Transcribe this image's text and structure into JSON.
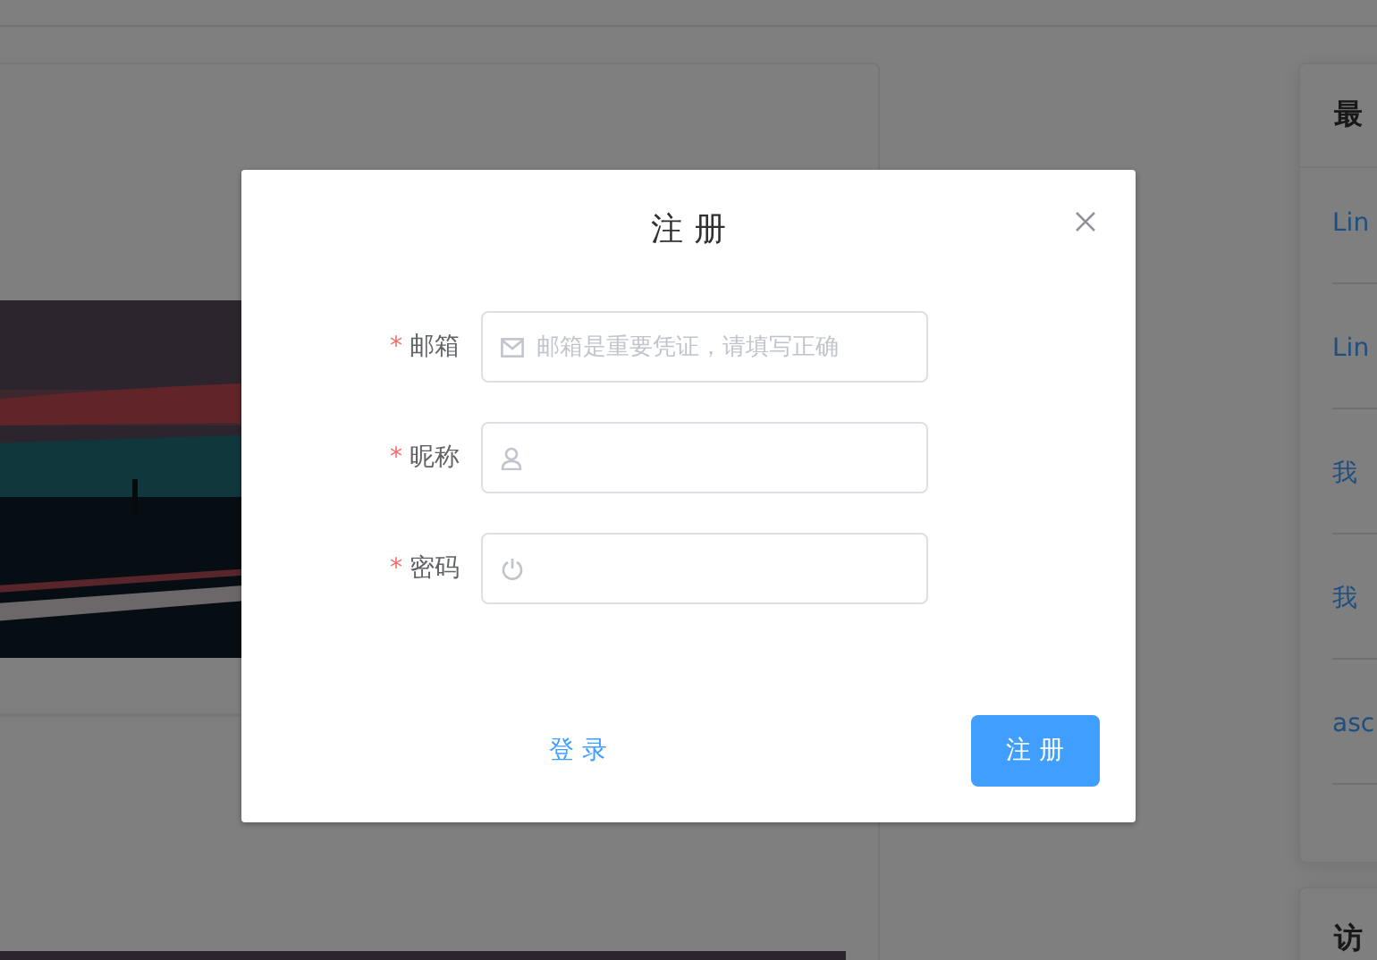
{
  "sidebar": {
    "cards": [
      {
        "title": "最",
        "links": [
          "Lin",
          "Lin",
          "我",
          "我",
          "asc"
        ]
      },
      {
        "title": "访"
      }
    ]
  },
  "dialog": {
    "title": "注 册",
    "fields": [
      {
        "kind": "email",
        "label": "邮箱",
        "required_mark": "*",
        "placeholder": "邮箱是重要凭证，请填写正确"
      },
      {
        "kind": "user",
        "label": "昵称",
        "required_mark": "*"
      },
      {
        "kind": "password",
        "label": "密码",
        "required_mark": "*"
      }
    ],
    "buttons": [
      {
        "kind": "text",
        "label": "登 录"
      },
      {
        "kind": "primary",
        "label": "注 册"
      }
    ]
  }
}
